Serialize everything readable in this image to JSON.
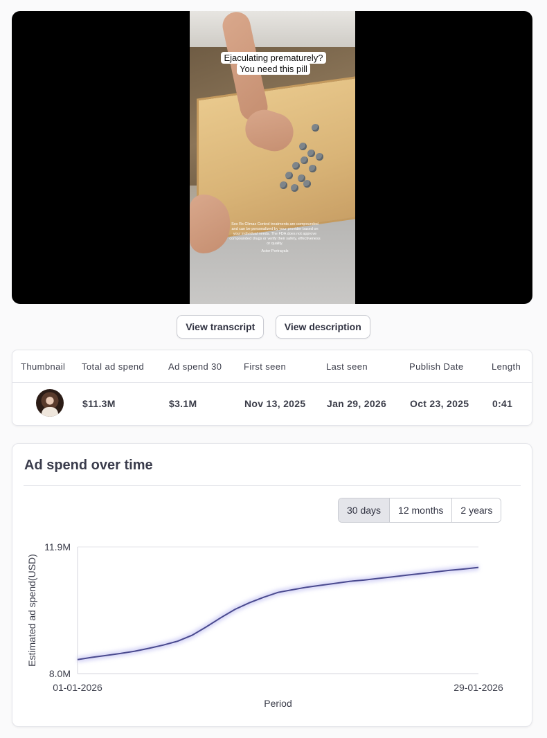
{
  "video": {
    "caption_line1": "Ejaculating prematurely?",
    "caption_line2": "You need this pill",
    "disclaimer": "Sex Rx Climax Control treatments are compounded and can be personalized by your provider based on your individual needs. The FDA does not approve compounded drugs or verify their safety, effectiveness or quality.",
    "disclaimer_byline": "Actor Portrayals"
  },
  "actions": {
    "transcript_label": "View transcript",
    "description_label": "View description"
  },
  "stats": {
    "headers": [
      "Thumbnail",
      "Total ad spend",
      "Ad spend 30",
      "First seen",
      "Last seen",
      "Publish Date",
      "Length"
    ],
    "values": {
      "total_ad_spend": "$11.3M",
      "ad_spend_30": "$3.1M",
      "first_seen": "Nov 13, 2025",
      "last_seen": "Jan 29, 2026",
      "publish_date": "Oct 23, 2025",
      "length": "0:41"
    }
  },
  "chart_card": {
    "title": "Ad spend over time",
    "ranges": [
      "30 days",
      "12 months",
      "2 years"
    ],
    "active_range": "30 days"
  },
  "chart_data": {
    "type": "line",
    "xlabel": "Period",
    "ylabel": "Estimated ad spend(USD)",
    "x_tick_labels": [
      "01-01-2026",
      "29-01-2026"
    ],
    "y_tick_labels": [
      "11.9M",
      "8.0M"
    ],
    "ylim": [
      8.0,
      11.9
    ],
    "grid": false,
    "line_color": "#4a4a8f",
    "x": [
      "01-01-2026",
      "02-01-2026",
      "03-01-2026",
      "04-01-2026",
      "05-01-2026",
      "06-01-2026",
      "07-01-2026",
      "08-01-2026",
      "09-01-2026",
      "10-01-2026",
      "11-01-2026",
      "12-01-2026",
      "13-01-2026",
      "14-01-2026",
      "15-01-2026",
      "16-01-2026",
      "17-01-2026",
      "18-01-2026",
      "19-01-2026",
      "20-01-2026",
      "21-01-2026",
      "22-01-2026",
      "23-01-2026",
      "24-01-2026",
      "25-01-2026",
      "26-01-2026",
      "27-01-2026",
      "28-01-2026",
      "29-01-2026"
    ],
    "series": [
      {
        "values": [
          8.43,
          8.5,
          8.56,
          8.62,
          8.69,
          8.78,
          8.88,
          9.0,
          9.18,
          9.44,
          9.72,
          9.98,
          10.18,
          10.35,
          10.5,
          10.58,
          10.66,
          10.72,
          10.78,
          10.84,
          10.88,
          10.93,
          10.98,
          11.03,
          11.08,
          11.13,
          11.18,
          11.22,
          11.27
        ]
      }
    ]
  }
}
